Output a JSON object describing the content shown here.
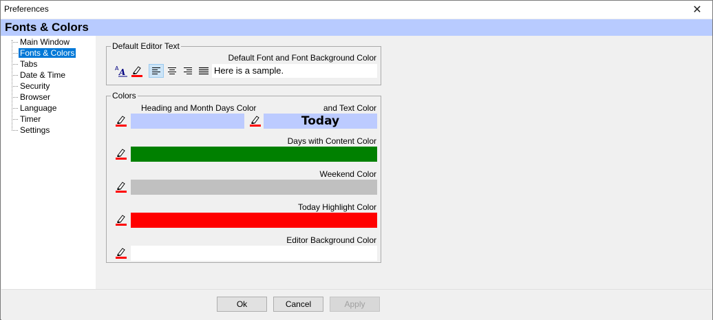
{
  "window": {
    "title": "Preferences",
    "close_glyph": "✕"
  },
  "header": {
    "title": "Fonts & Colors"
  },
  "sidebar": {
    "items": [
      {
        "label": "Main Window",
        "selected": false
      },
      {
        "label": "Fonts & Colors",
        "selected": true
      },
      {
        "label": "Tabs",
        "selected": false
      },
      {
        "label": "Date & Time",
        "selected": false
      },
      {
        "label": "Security",
        "selected": false
      },
      {
        "label": "Browser",
        "selected": false
      },
      {
        "label": "Language",
        "selected": false
      },
      {
        "label": "Timer",
        "selected": false
      },
      {
        "label": "Settings",
        "selected": false
      }
    ]
  },
  "editor_text": {
    "group_label": "Default Editor Text",
    "font_label": "Default Font and Font Background Color",
    "sample_text": "Here is a sample.",
    "align_active": "left"
  },
  "colors": {
    "group_label": "Colors",
    "heading_label": "Heading and Month Days Color",
    "heading_color": "#bccbff",
    "text_color_label": "and Text Color",
    "today_label": "Today",
    "days_content_label": "Days with Content Color",
    "days_content_color": "#008000",
    "weekend_label": "Weekend Color",
    "weekend_color": "#c0c0c0",
    "today_highlight_label": "Today Highlight Color",
    "today_highlight_color": "#ff0000",
    "editor_bg_label": "Editor Background Color",
    "editor_bg_color": "#ffffff"
  },
  "footer": {
    "ok_label": "Ok",
    "cancel_label": "Cancel",
    "apply_label": "Apply"
  },
  "icons": {
    "font": "font-icon",
    "highlighter": "highlighter-icon",
    "align_left": "align-left-icon",
    "align_center": "align-center-icon",
    "align_right": "align-right-icon",
    "align_justify": "align-justify-icon",
    "close": "close-icon"
  }
}
